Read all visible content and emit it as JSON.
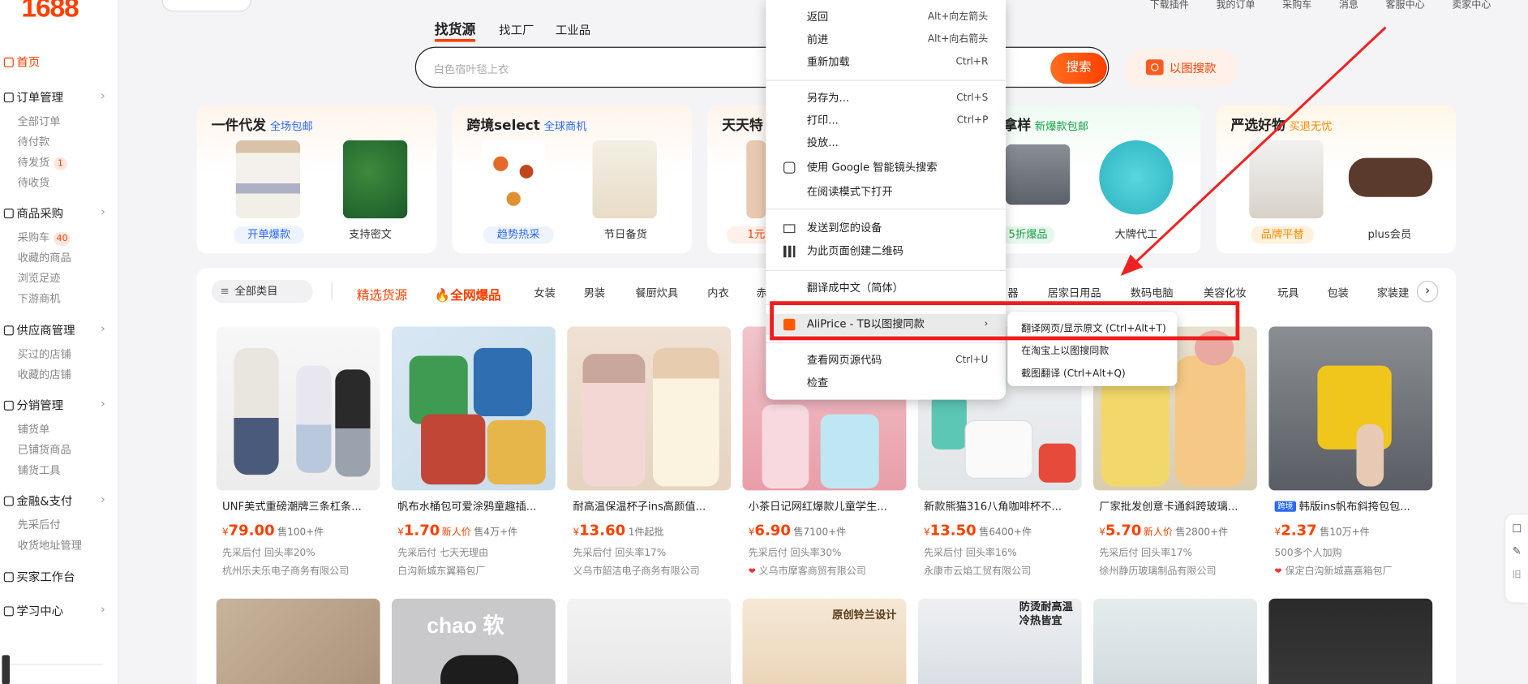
{
  "sidebar": {
    "logo": "1688",
    "home": "首页",
    "sections": [
      {
        "label": "订单管理",
        "items": [
          "全部订单",
          "待付款",
          "待发货",
          "待收货"
        ],
        "badge_item": 2,
        "badge": "1"
      },
      {
        "label": "商品采购",
        "items": [
          "采购车",
          "收藏的商品",
          "浏览足迹",
          "下游商机"
        ],
        "badge_item": 0,
        "badge": "40"
      },
      {
        "label": "供应商管理",
        "items": [
          "买过的店铺",
          "收藏的店铺"
        ]
      },
      {
        "label": "分销管理",
        "items": [
          "铺货单",
          "已铺货商品",
          "铺货工具"
        ]
      },
      {
        "label": "金融&支付",
        "items": [
          "先采后付",
          "收货地址管理"
        ]
      },
      {
        "label": "买家工作台",
        "items": []
      },
      {
        "label": "学习中心",
        "items": []
      }
    ]
  },
  "topnav": [
    "下载插件",
    "我的订单",
    "采购车",
    "消息",
    "客服中心",
    "卖家中心"
  ],
  "search": {
    "tabs": [
      "找货源",
      "找工厂",
      "工业品"
    ],
    "placeholder": "白色宿叶毯上衣",
    "button": "搜索",
    "image_search": "以图搜款"
  },
  "promos": [
    {
      "title": "一件代发",
      "sub": "全场包邮",
      "sub_color": "#2b68ff",
      "labels": [
        "开单爆款",
        "支持密文"
      ]
    },
    {
      "title": "跨境select",
      "sub": "全球商机",
      "sub_color": "#2b68ff",
      "labels": [
        "趋势热采",
        "节日备货"
      ]
    },
    {
      "title": "天天特",
      "sub": "",
      "sub_color": "#ff4000",
      "labels": [
        "1元",
        ""
      ]
    },
    {
      "title": "拿样",
      "sub": "新爆款包邮",
      "sub_color": "#18a34a",
      "labels": [
        "5折爆品",
        "大牌代工"
      ]
    },
    {
      "title": "严选好物",
      "sub": "买退无忧",
      "sub_color": "#ff8a00",
      "labels": [
        "品牌平替",
        "plus会员"
      ]
    }
  ],
  "categories": {
    "all": "全部类目",
    "selected": "精选货源",
    "hot": "全网爆品",
    "items": [
      "女装",
      "男装",
      "餐厨炊具",
      "内衣",
      "赤",
      "器",
      "居家日用品",
      "数码电脑",
      "美容化妆",
      "玩具",
      "包装",
      "家装建"
    ]
  },
  "products": [
    {
      "title": "UNF美式重磅潮牌三条杠条...",
      "currency": "¥",
      "price": "79.00",
      "tag": "",
      "sold": "售100+件",
      "service": "先采后付  回头率20%",
      "company": "杭州乐夫乐电子商务有限公司",
      "company_mark": ""
    },
    {
      "title": "帆布水桶包可爱涂鸦童趣插...",
      "currency": "¥",
      "price": "1.70",
      "tag": "新人价",
      "sold": "售4万+件",
      "service": "先采后付  七天无理由",
      "company": "白沟新城东翼箱包厂",
      "company_mark": ""
    },
    {
      "title": "耐高温保温杯子ins高颜值...",
      "currency": "¥",
      "price": "13.60",
      "tag": "",
      "sold": "1件起批",
      "service": "先采后付  回头率17%",
      "company": "义乌市韶洁电子商务有限公司",
      "company_mark": ""
    },
    {
      "title": "小茶日记网红爆款儿童学生...",
      "currency": "¥",
      "price": "6.90",
      "tag": "",
      "sold": "售7100+件",
      "service": "先采后付  回头率30%",
      "company": "义乌市摩客商贸有限公司",
      "company_mark": "❤"
    },
    {
      "title": "新款熊猫316八角咖啡杯不...",
      "currency": "¥",
      "price": "13.50",
      "tag": "",
      "sold": "售6400+件",
      "service": "先采后付  回头率16%",
      "company": "永康市云焰工贸有限公司",
      "company_mark": ""
    },
    {
      "title": "厂家批发创意卡通斜跨玻璃...",
      "currency": "¥",
      "price": "5.70",
      "tag": "新人价",
      "sold": "售2800+件",
      "service": "先采后付  回头率17%",
      "company": "徐州静历玻璃制品有限公司",
      "company_mark": ""
    },
    {
      "title": "韩版ins帆布斜挎包包...",
      "currency": "¥",
      "price": "2.37",
      "tag": "",
      "sold": "售10万+件",
      "service": "500多个人加购",
      "company": "保定白沟新城嘉嘉箱包厂",
      "company_mark": "❤",
      "badge": "跨境"
    }
  ],
  "row2_texts": [
    "chao 软",
    "原创铃兰设计",
    "防烫耐高温\n冷热皆宜"
  ],
  "context_menu": {
    "items": [
      {
        "label": "返回",
        "shortcut": "Alt+向左箭头"
      },
      {
        "label": "前进",
        "shortcut": "Alt+向右箭头"
      },
      {
        "label": "重新加载",
        "shortcut": "Ctrl+R"
      },
      {
        "label": "另存为...",
        "shortcut": "Ctrl+S"
      },
      {
        "label": "打印...",
        "shortcut": "Ctrl+P"
      },
      {
        "label": "投放...",
        "shortcut": ""
      },
      {
        "label": "使用 Google 智能镜头搜索",
        "shortcut": ""
      },
      {
        "label": "在阅读模式下打开",
        "shortcut": ""
      },
      {
        "label": "发送到您的设备",
        "shortcut": ""
      },
      {
        "label": "为此页面创建二维码",
        "shortcut": ""
      },
      {
        "label": "翻译成中文（简体）",
        "shortcut": ""
      },
      {
        "label": "AliPrice - TB以图搜同款",
        "shortcut": "›"
      },
      {
        "label": "查看网页源代码",
        "shortcut": "Ctrl+U"
      },
      {
        "label": "检查",
        "shortcut": ""
      }
    ],
    "submenu": [
      "翻译网页/显示原文 (Ctrl+Alt+T)",
      "在淘宝上以图搜同款",
      "截图翻译 (Ctrl+Alt+Q)"
    ]
  },
  "right_float": [
    "☐",
    "✎",
    "旧"
  ],
  "accent": "#ff4000"
}
